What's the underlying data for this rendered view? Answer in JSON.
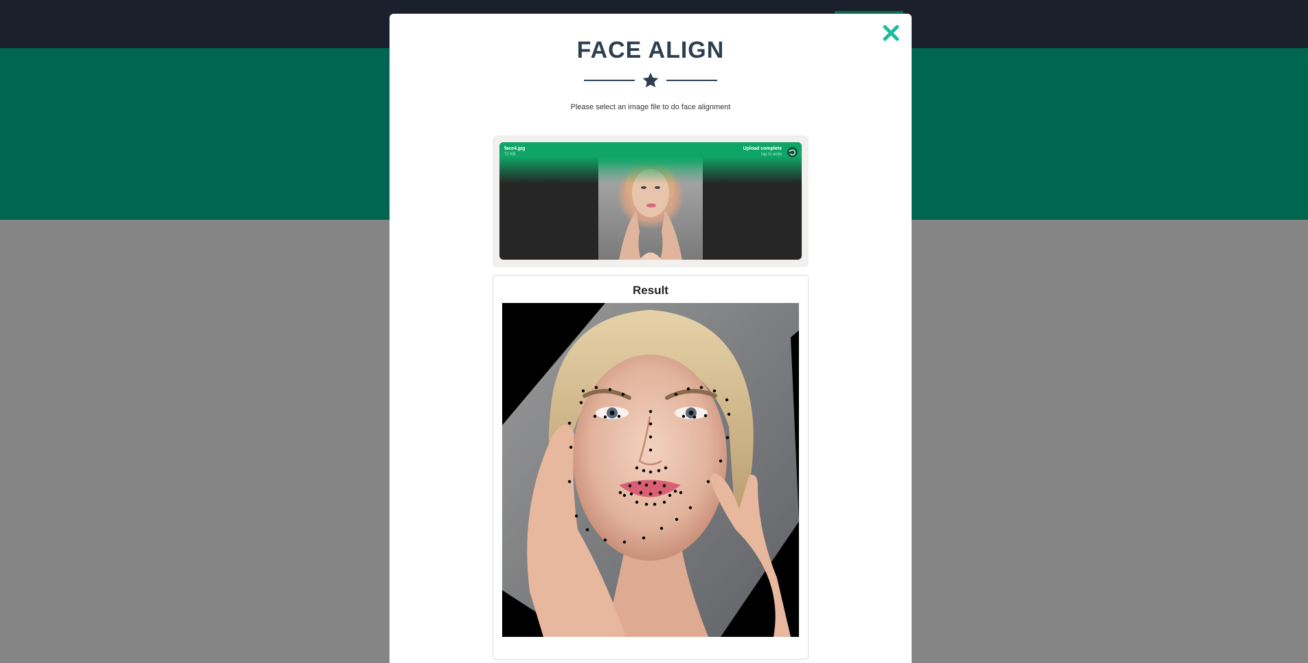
{
  "modal": {
    "title": "FACE ALIGN",
    "subtitle": "Please select an image file to do face alignment"
  },
  "upload": {
    "file_name": "face4.jpg",
    "file_size": "72 KB",
    "status": "Upload complete",
    "status_hint": "tap to undo"
  },
  "result": {
    "title": "Result"
  },
  "icons": {
    "close": "close-icon",
    "star": "star-icon",
    "undo": "undo-icon"
  },
  "colors": {
    "accent": "#1abc9c",
    "hero": "#006650",
    "topbar": "#1a202c",
    "upload_green": "#0ea566",
    "title": "#2c3e50"
  }
}
